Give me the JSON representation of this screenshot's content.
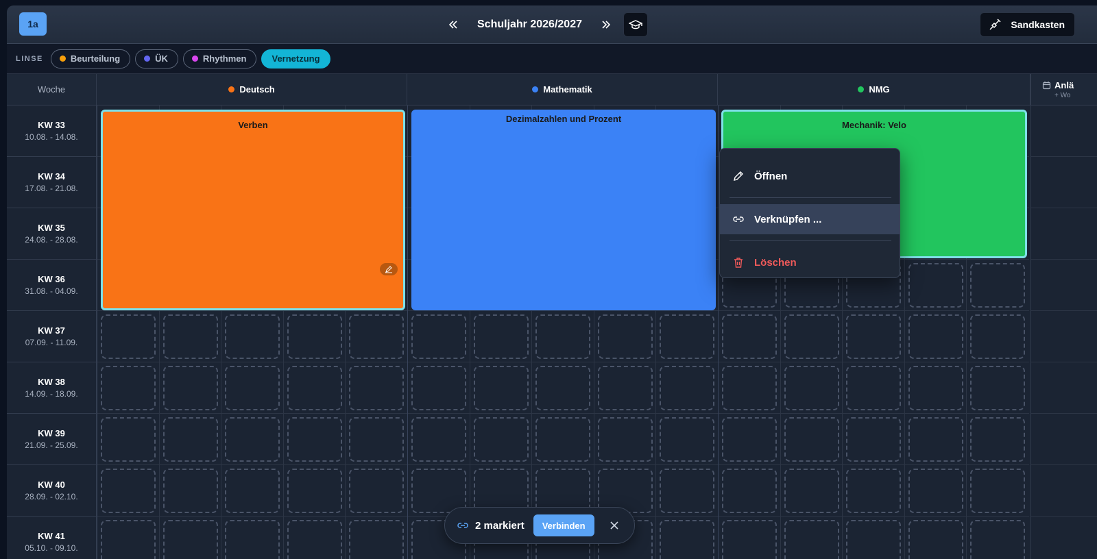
{
  "header": {
    "class_label": "1a",
    "year_title": "Schuljahr 2026/2027",
    "sandbox_label": "Sandkasten"
  },
  "lens": {
    "label": "LINSE",
    "pills": [
      {
        "label": "Beurteilung",
        "color": "#f59e0b"
      },
      {
        "label": "ÜK",
        "color": "#6366f1"
      },
      {
        "label": "Rhythmen",
        "color": "#d946ef"
      },
      {
        "label": "Vernetzung",
        "active": true
      }
    ]
  },
  "grid": {
    "week_header": "Woche",
    "subjects": [
      {
        "name": "Deutsch",
        "color": "#f97316"
      },
      {
        "name": "Mathematik",
        "color": "#3b82f6"
      },
      {
        "name": "NMG",
        "color": "#22c55e"
      }
    ],
    "extra_column": {
      "title": "Anlä",
      "sub": "+ Wo"
    },
    "weeks": [
      {
        "kw": "KW 33",
        "dates": "10.08. - 14.08."
      },
      {
        "kw": "KW 34",
        "dates": "17.08. - 21.08."
      },
      {
        "kw": "KW 35",
        "dates": "24.08. - 28.08."
      },
      {
        "kw": "KW 36",
        "dates": "31.08. - 04.09."
      },
      {
        "kw": "KW 37",
        "dates": "07.09. - 11.09."
      },
      {
        "kw": "KW 38",
        "dates": "14.09. - 18.09."
      },
      {
        "kw": "KW 39",
        "dates": "21.09. - 25.09."
      },
      {
        "kw": "KW 40",
        "dates": "28.09. - 02.10."
      },
      {
        "kw": "KW 41",
        "dates": "05.10. - 09.10."
      }
    ],
    "blocks": [
      {
        "title": "Verben",
        "color": "#f97316",
        "selected": true
      },
      {
        "title": "Dezimalzahlen und Prozent",
        "color": "#3b82f6",
        "selected": false
      },
      {
        "title": "Mechanik: Velo",
        "color": "#22c55e",
        "selected": true
      }
    ]
  },
  "context_menu": {
    "open": "Öffnen",
    "link": "Verknüpfen ...",
    "delete": "Löschen"
  },
  "selection_bar": {
    "count_label": "2 markiert",
    "connect_label": "Verbinden"
  },
  "colors": {
    "accent": "#5aa3f5",
    "active_lens": "#13b5d6",
    "selected_outline": "#7ee0e8",
    "danger": "#f05a5a"
  }
}
